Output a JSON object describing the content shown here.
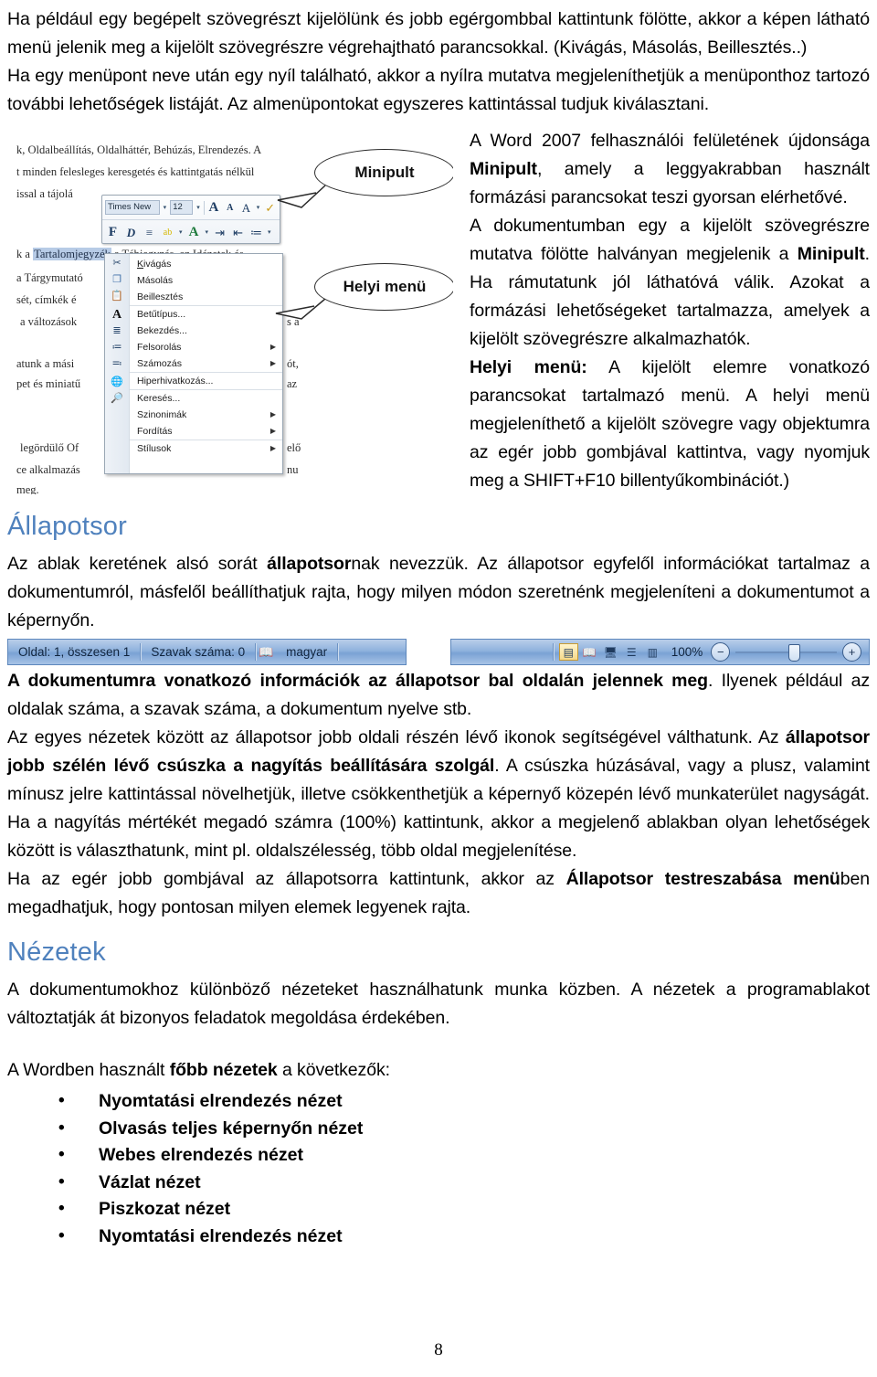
{
  "document": {
    "page_number": "8",
    "heading_color": "#4f81bd"
  },
  "intro": {
    "para1": "Ha például egy begépelt szövegrészt kijelölünk és jobb egérgombbal kattintunk fölötte, akkor a képen látható menü jelenik meg a kijelölt szövegrészre végrehajtható parancsokkal. (Kivágás, Másolás, Beillesztés..)",
    "para2": "Ha egy menüpont neve után egy nyíl található, akkor a nyílra mutatva megjeleníthetjük a menüponthoz tartozó további lehetőségek listáját. Az almenüpontokat egyszeres kattintással tudjuk kiválasztani."
  },
  "figure": {
    "callout_minipult": "Minipult",
    "callout_helyi_menu": "Helyi menü",
    "background_lines": [
      "k, Oldalbeállítás, Oldalháttér, Behúzás, Elrendezés. A",
      "t minden felesleges keresgetés és kattintgatás nélkül",
      "issal a tájolá",
      "k a ",
      "a Tárgymutató",
      "sét, címkék é",
      "a változások",
      "atunk a mási",
      "pet és miniatű",
      "legördülő Of",
      "ce alkalmazás",
      "meg."
    ],
    "selected_text": "Tartalomjegyzék",
    "bg_tail_1": " a Tábjegyzés, az Idézetek és",
    "bg_tail_2": "s a",
    "bg_tail_3": "ót,",
    "bg_tail_4": "az",
    "bg_tail_5": "elő",
    "bg_tail_6": "nu",
    "minipult": {
      "font_name": "Times New",
      "font_size": "12",
      "grow_font": "A",
      "shrink_font": "A",
      "clear_format": "A",
      "format_painter": "✓",
      "bold": "F",
      "italic": "D",
      "center": "≡",
      "highlight": "ab",
      "font_color": "A",
      "decrease_indent": "⇥",
      "increase_indent": "⇤",
      "bullets": "≔"
    },
    "context_menu": [
      {
        "label": "Kivágás",
        "mnemonic": "K",
        "submenu": false,
        "separator_before": false
      },
      {
        "label": "Másolás",
        "mnemonic": "M",
        "submenu": false,
        "separator_before": false
      },
      {
        "label": "Beillesztés",
        "mnemonic": "B",
        "submenu": false,
        "separator_before": false
      },
      {
        "label": "Betűtípus...",
        "mnemonic": "e",
        "submenu": false,
        "separator_before": true
      },
      {
        "label": "Bekezdés...",
        "mnemonic": "d",
        "submenu": false,
        "separator_before": false
      },
      {
        "label": "Felsorolás",
        "mnemonic": "F",
        "submenu": true,
        "separator_before": false
      },
      {
        "label": "Számozás",
        "mnemonic": "S",
        "submenu": true,
        "separator_before": false
      },
      {
        "label": "Hiperhivatkozás...",
        "mnemonic": "H",
        "submenu": false,
        "separator_before": true
      },
      {
        "label": "Keresés...",
        "mnemonic": "K",
        "submenu": false,
        "separator_before": true
      },
      {
        "label": "Szinonimák",
        "mnemonic": "S",
        "submenu": true,
        "separator_before": false
      },
      {
        "label": "Fordítás",
        "mnemonic": "F",
        "submenu": true,
        "separator_before": false
      },
      {
        "label": "Stílusok",
        "mnemonic": "S",
        "submenu": true,
        "separator_before": true
      }
    ]
  },
  "right_column": {
    "p1_a": "A Word 2007 felhasználói felületének újdonsága ",
    "p1_b": "Minipult",
    "p1_c": ", amely a leggyakrabban használt formázási parancsokat teszi gyorsan elérhetővé.",
    "p2_a": "A dokumentumban egy a kijelölt szövegrészre mutatva fölötte halványan megjelenik a ",
    "p2_b": "Minipult",
    "p2_c": ". Ha rámutatunk jól láthatóvá válik. Azokat a formázási lehetőségeket tartalmazza, amelyek a kijelölt szövegrészre alkalmazhatók.",
    "p3_a": "Helyi menü:",
    "p3_b": " A kijelölt elemre vonatkozó parancsokat tartalmazó menü. A helyi menü megjeleníthető a kijelölt szövegre vagy objektumra az egér jobb gombjával kattintva, vagy nyomjuk meg a SHIFT+F10 billentyűkombinációt.)"
  },
  "status_section": {
    "heading": "Állapotsor",
    "para1_a": "Az ablak keretének alsó sorát ",
    "para1_b": "állapotsor",
    "para1_c": "nak nevezzük. Az állapotsor egyfelől információkat tartalmaz a dokumentumról, másfelől beállíthatjuk rajta, hogy milyen módon szeretnénk megjeleníteni a dokumentumot a képernyőn.",
    "para2_a": "A dokumentumra vonatkozó információk az állapotsor bal oldalán jelennek meg",
    "para2_b": ". Ilyenek például az oldalak száma, a szavak száma, a dokumentum nyelve stb.",
    "para3_a": "Az egyes nézetek között az állapotsor jobb oldali részén lévő ikonok segítségével válthatunk. Az ",
    "para3_b": "állapotsor jobb szélén lévő csúszka a nagyítás beállítására szolgál",
    "para3_c": ". A csúszka húzásával, vagy a plusz, valamint mínusz jelre kattintással növelhetjük, illetve csökkenthetjük a képernyő közepén lévő munkaterület nagyságát. Ha a nagyítás mértékét megadó számra (100%) kattintunk, akkor a megjelenő ablakban olyan lehetőségek között is választhatunk, mint pl. oldalszélesség, több oldal megjelenítése.",
    "para4_a": "Ha az egér jobb gombjával az állapotsorra kattintunk, akkor az ",
    "para4_b": "Állapotsor testreszabása menü",
    "para4_c": "ben megadhatjuk, hogy pontosan milyen elemek legyenek rajta."
  },
  "statusbar_graphic": {
    "page_info": "Oldal: 1, összesen 1",
    "word_count": "Szavak száma: 0",
    "proofing_icon": "proofing-icon",
    "language": "magyar",
    "view_print_layout": "print-layout-icon",
    "view_full_screen": "full-screen-reading-icon",
    "view_web_layout": "web-layout-icon",
    "view_outline": "outline-icon",
    "view_draft": "draft-icon",
    "zoom_level": "100%",
    "zoom_out": "−",
    "zoom_in": "+"
  },
  "views_section": {
    "heading": "Nézetek",
    "para1": "A dokumentumokhoz különböző nézeteket használhatunk munka közben. A nézetek a programablakot változtatják át bizonyos feladatok megoldása érdekében.",
    "para2_a": "A Wordben használt ",
    "para2_b": "főbb nézetek",
    "para2_c": " a következők:",
    "items": [
      "Nyomtatási elrendezés nézet",
      "Olvasás teljes képernyőn nézet",
      "Webes elrendezés nézet",
      "Vázlat nézet",
      "Piszkozat nézet",
      "Nyomtatási elrendezés nézet"
    ]
  }
}
